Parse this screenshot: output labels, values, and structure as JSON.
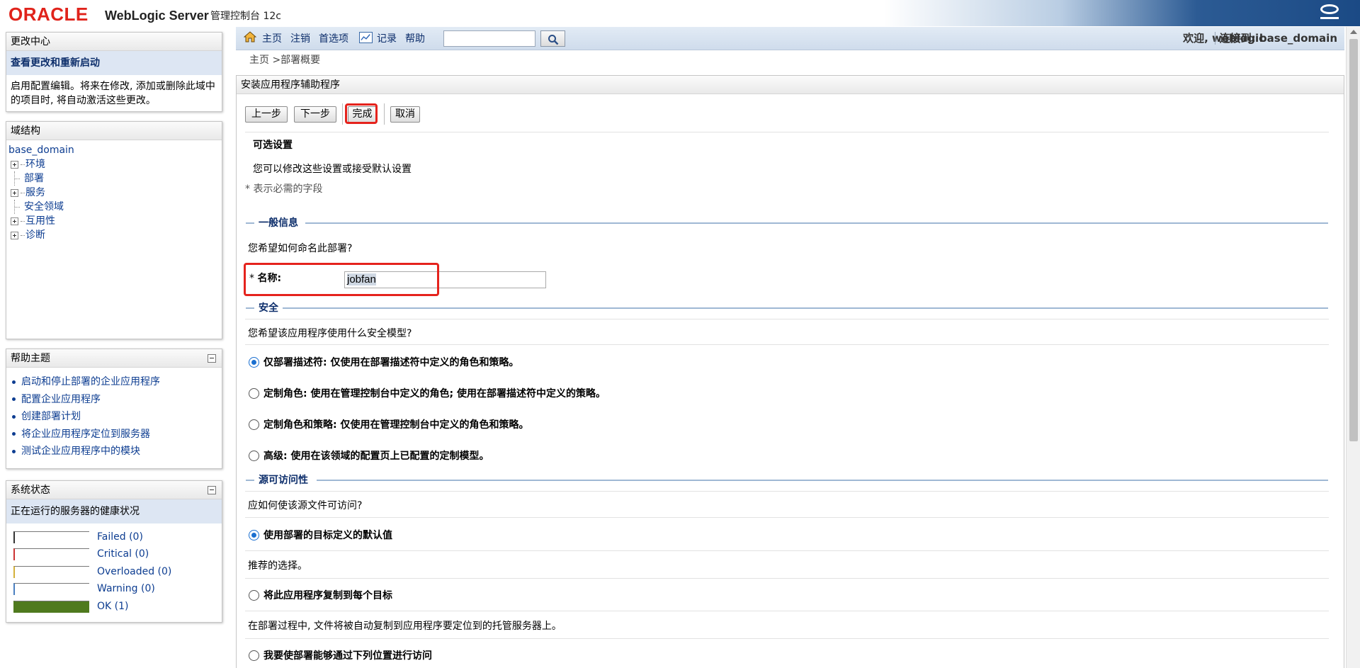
{
  "header": {
    "logo": "ORACLE",
    "product": "WebLogic Server",
    "subtitle": "管理控制台 12c"
  },
  "sidebar": {
    "change_center": {
      "title": "更改中心",
      "link": "查看更改和重新启动",
      "description": "启用配置编辑。将来在修改, 添加或删除此域中的项目时, 将自动激活这些更改。"
    },
    "domain_structure": {
      "title": "域结构",
      "root": "base_domain",
      "items": [
        {
          "label": "环境",
          "expandable": true
        },
        {
          "label": "部署",
          "expandable": false
        },
        {
          "label": "服务",
          "expandable": true
        },
        {
          "label": "安全领域",
          "expandable": false
        },
        {
          "label": "互用性",
          "expandable": true
        },
        {
          "label": "诊断",
          "expandable": true
        }
      ]
    },
    "help_topics": {
      "title": "帮助主题",
      "items": [
        "启动和停止部署的企业应用程序",
        "配置企业应用程序",
        "创建部署计划",
        "将企业应用程序定位到服务器",
        "测试企业应用程序中的模块"
      ]
    },
    "system_status": {
      "title": "系统状态",
      "subtitle": "正在运行的服务器的健康状况",
      "items": [
        {
          "label": "Failed (0)",
          "color": "#333333",
          "fill": 0
        },
        {
          "label": "Critical (0)",
          "color": "#cc3333",
          "fill": 0
        },
        {
          "label": "Overloaded (0)",
          "color": "#d4b03a",
          "fill": 0
        },
        {
          "label": "Warning (0)",
          "color": "#4a7fc0",
          "fill": 0
        },
        {
          "label": "OK (1)",
          "color": "#4f7a1e",
          "fill": 1
        }
      ]
    }
  },
  "toolbar": {
    "home": "主页",
    "logout": "注销",
    "preferences": "首选项",
    "record": "记录",
    "help": "帮助",
    "search_value": "",
    "welcome": "欢迎, weblogic",
    "connected": "连接到: base_domain"
  },
  "breadcrumb": "主页 >部署概要",
  "wizard": {
    "title": "安装应用程序辅助程序",
    "buttons": {
      "back": "上一步",
      "next": "下一步",
      "finish": "完成",
      "cancel": "取消"
    },
    "heading": "可选设置",
    "intro": "您可以修改这些设置或接受默认设置",
    "required_note": "* 表示必需的字段",
    "general": {
      "section": "一般信息",
      "question": "您希望如何命名此部署?",
      "name_label": "名称:",
      "name_value": "jobfan"
    },
    "security": {
      "section": "安全",
      "question": "您希望该应用程序使用什么安全模型?",
      "options": [
        {
          "label": "仅部署描述符: 仅使用在部署描述符中定义的角色和策略。",
          "checked": true
        },
        {
          "label": "定制角色: 使用在管理控制台中定义的角色; 使用在部署描述符中定义的策略。",
          "checked": false
        },
        {
          "label": "定制角色和策略: 仅使用在管理控制台中定义的角色和策略。",
          "checked": false
        },
        {
          "label": "高级: 使用在该领域的配置页上已配置的定制模型。",
          "checked": false
        }
      ]
    },
    "source": {
      "section": "源可访问性",
      "question": "应如何使该源文件可访问?",
      "option1": "使用部署的目标定义的默认值",
      "option1_note": "推荐的选择。",
      "option2": "将此应用程序复制到每个目标",
      "option2_note": "在部署过程中, 文件将被自动复制到应用程序要定位到的托管服务器上。",
      "option3": "我要使部署能够通过下列位置进行访问"
    }
  }
}
